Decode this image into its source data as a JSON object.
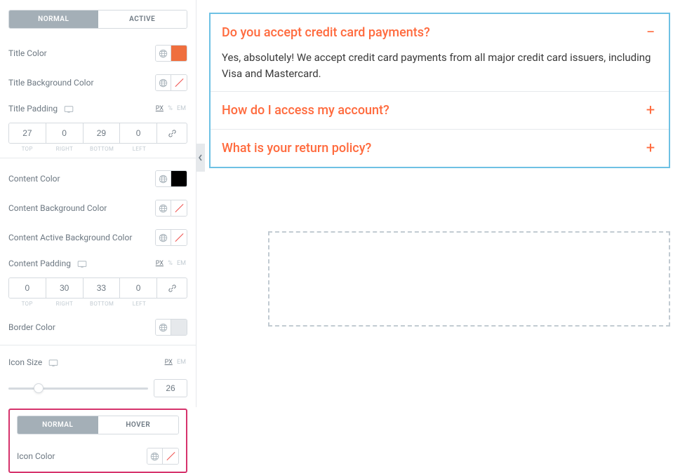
{
  "tabs_top": {
    "normal": "NORMAL",
    "active": "ACTIVE"
  },
  "title_color": {
    "label": "Title Color",
    "swatch": "#ef6f3e"
  },
  "title_bg": {
    "label": "Title Background Color"
  },
  "title_padding": {
    "label": "Title Padding",
    "top": "27",
    "right": "0",
    "bottom": "29",
    "left": "0"
  },
  "units": {
    "px": "PX",
    "pct": "%",
    "em": "EM"
  },
  "pad_labels": {
    "top": "TOP",
    "right": "RIGHT",
    "bottom": "BOTTOM",
    "left": "LEFT"
  },
  "content_color": {
    "label": "Content Color",
    "swatch": "#000000"
  },
  "content_bg": {
    "label": "Content Background Color"
  },
  "content_active_bg": {
    "label": "Content Active Background Color"
  },
  "content_padding": {
    "label": "Content Padding",
    "top": "0",
    "right": "30",
    "bottom": "33",
    "left": "0"
  },
  "border_color": {
    "label": "Border Color",
    "swatch": "#e6e9ec"
  },
  "icon_size": {
    "label": "Icon Size",
    "value": "26"
  },
  "tabs_icon": {
    "normal": "NORMAL",
    "hover": "HOVER"
  },
  "icon_color": {
    "label": "Icon Color"
  },
  "accordion": {
    "items": [
      {
        "title": "Do you accept credit card payments?",
        "icon": "−",
        "body": "Yes, absolutely! We accept credit card payments from all major credit card issuers, including Visa and Mastercard."
      },
      {
        "title": "How do I access my account?",
        "icon": "+"
      },
      {
        "title": "What is your return policy?",
        "icon": "+"
      }
    ]
  }
}
